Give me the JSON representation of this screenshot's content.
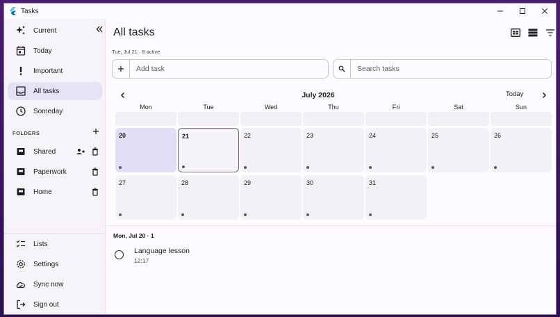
{
  "window": {
    "title": "Tasks"
  },
  "sidebar": {
    "nav": [
      {
        "label": "Current",
        "icon": "sparkle-icon"
      },
      {
        "label": "Today",
        "icon": "calendar-today-icon"
      },
      {
        "label": "Important",
        "icon": "exclamation-icon"
      },
      {
        "label": "All tasks",
        "icon": "inbox-icon",
        "active": true
      },
      {
        "label": "Someday",
        "icon": "clock-icon"
      }
    ],
    "folders_title": "FOLDERS",
    "folders": [
      {
        "label": "Shared",
        "shared": true
      },
      {
        "label": "Paperwork"
      },
      {
        "label": "Home"
      }
    ],
    "bottom": [
      {
        "label": "Lists",
        "icon": "checklist-icon"
      },
      {
        "label": "Settings",
        "icon": "gear-icon"
      },
      {
        "label": "Sync now",
        "icon": "cloud-sync-icon"
      },
      {
        "label": "Sign out",
        "icon": "logout-icon"
      }
    ]
  },
  "main": {
    "title": "All tasks",
    "subtitle": "Tue, Jul 21 · 8 active",
    "add_placeholder": "Add task",
    "search_placeholder": "Search tasks",
    "month": "July 2026",
    "today_label": "Today",
    "weekdays": [
      "Mon",
      "Tue",
      "Wed",
      "Thu",
      "Fri",
      "Sat",
      "Sun"
    ],
    "days": [
      "20",
      "21",
      "22",
      "23",
      "24",
      "25",
      "26",
      "27",
      "28",
      "29",
      "30",
      "31"
    ],
    "selected_day": "20",
    "today_day": "21",
    "day_header": "Mon, Jul 20 · 1",
    "tasks": [
      {
        "title": "Language lesson",
        "time": "12:17"
      }
    ]
  },
  "colors": {
    "accent_selected": "#e3ddf6",
    "sidebar_active": "#e6e1f5",
    "cell_bg": "#f3f0f6",
    "dot": "#5b5670"
  }
}
